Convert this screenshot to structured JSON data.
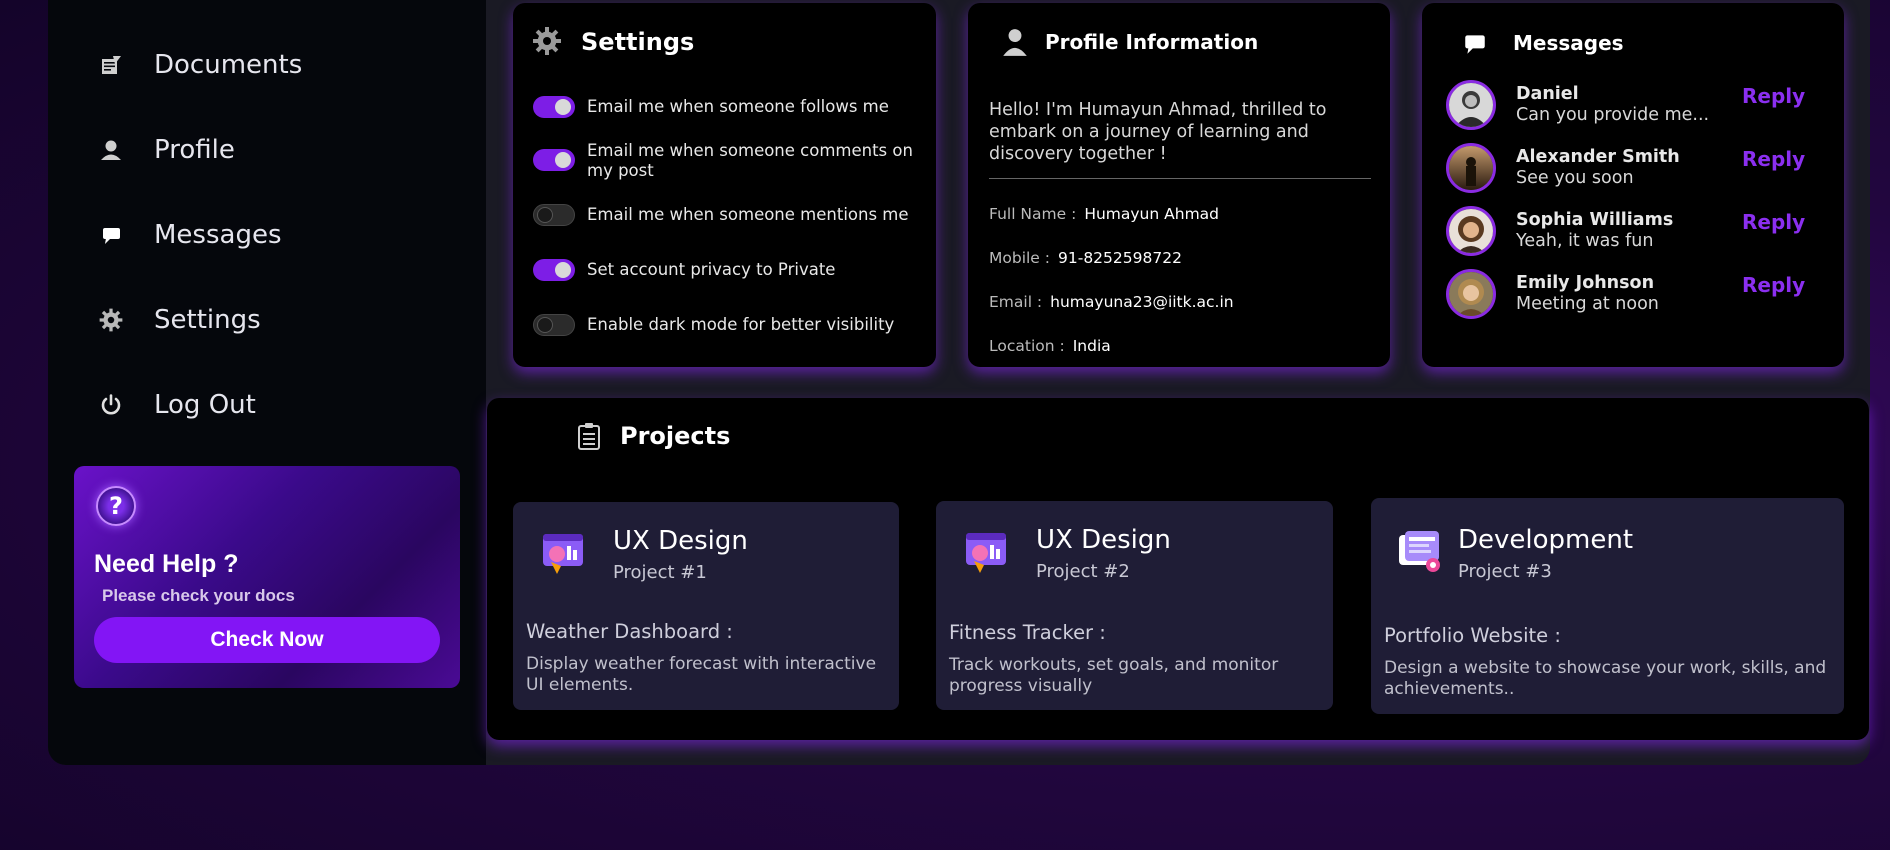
{
  "sidebar": {
    "items": [
      {
        "label": "Documents",
        "icon": "documents-icon"
      },
      {
        "label": "Profile",
        "icon": "profile-icon"
      },
      {
        "label": "Messages",
        "icon": "messages-icon"
      },
      {
        "label": "Settings",
        "icon": "settings-icon"
      },
      {
        "label": "Log Out",
        "icon": "power-icon"
      }
    ],
    "help": {
      "icon": "question-icon",
      "title": "Need Help ?",
      "subtitle": "Please check your docs",
      "button_label": "Check Now"
    }
  },
  "settings": {
    "title": "Settings",
    "toggles": [
      {
        "label": "Email me when someone follows me",
        "on": true
      },
      {
        "label": "Email me when someone comments on my post",
        "on": true
      },
      {
        "label": "Email me when someone mentions me",
        "on": false
      },
      {
        "label": "Set account privacy to Private",
        "on": true
      },
      {
        "label": "Enable dark mode for better visibility",
        "on": false
      }
    ]
  },
  "profile": {
    "title": "Profile Information",
    "bio": "Hello! I'm Humayun Ahmad, thrilled to embark on a journey of learning and discovery together !",
    "fields": [
      {
        "key": "Full Name :",
        "value": "Humayun Ahmad"
      },
      {
        "key": "Mobile :",
        "value": "91-8252598722"
      },
      {
        "key": "Email :",
        "value": "humayuna23@iitk.ac.in"
      },
      {
        "key": "Location :",
        "value": "India"
      }
    ]
  },
  "messages": {
    "title": "Messages",
    "reply_label": "Reply",
    "items": [
      {
        "name": "Daniel",
        "text": "Can you provide me..."
      },
      {
        "name": "Alexander Smith",
        "text": "See you soon"
      },
      {
        "name": "Sophia Williams",
        "text": "Yeah, it was fun"
      },
      {
        "name": "Emily Johnson",
        "text": "Meeting at noon"
      }
    ]
  },
  "projects": {
    "title": "Projects",
    "items": [
      {
        "name": "UX Design",
        "number": "Project #1",
        "subtitle": "Weather Dashboard :",
        "description": "Display weather forecast with interactive UI elements."
      },
      {
        "name": "UX Design",
        "number": "Project #2",
        "subtitle": "Fitness Tracker :",
        "description": "Track workouts, set goals, and monitor progress visually"
      },
      {
        "name": "Development",
        "number": "Project #3",
        "subtitle": "Portfolio Website :",
        "description": "Design a website to showcase your work, skills, and achievements.."
      }
    ]
  },
  "colors": {
    "accent": "#8315f5",
    "reply": "#8b2ff0",
    "card_bg": "#000000",
    "project_card_bg": "#1f1d36"
  }
}
